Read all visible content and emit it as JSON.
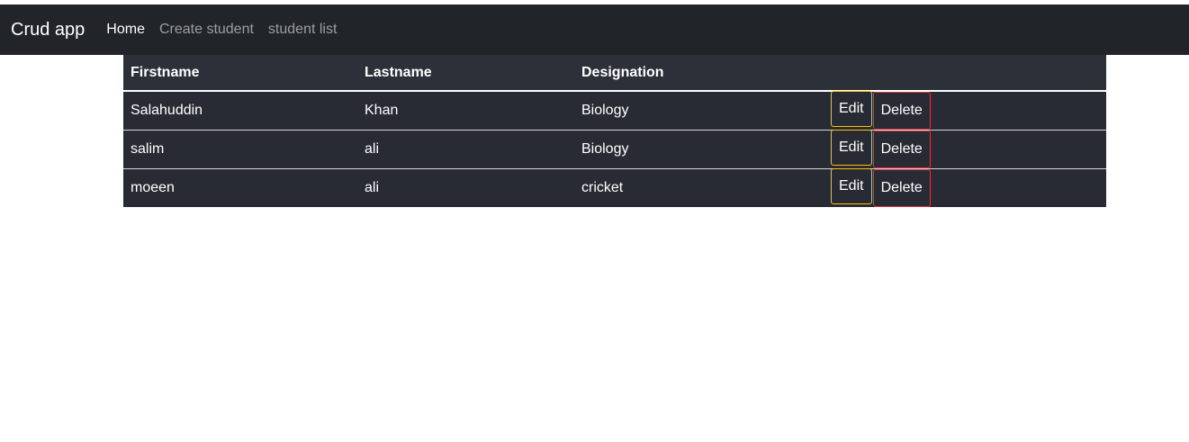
{
  "navbar": {
    "brand": "Crud app",
    "links": [
      {
        "label": "Home"
      },
      {
        "label": "Create student"
      },
      {
        "label": "student list"
      }
    ]
  },
  "table": {
    "headers": [
      "Firstname",
      "Lastname",
      "Designation",
      ""
    ],
    "rows": [
      {
        "firstname": "Salahuddin",
        "lastname": "Khan",
        "designation": "Biology"
      },
      {
        "firstname": "salim",
        "lastname": "ali",
        "designation": "Biology"
      },
      {
        "firstname": "moeen",
        "lastname": "ali",
        "designation": "cricket"
      }
    ],
    "edit_label": "Edit",
    "delete_label": "Delete"
  },
  "colors": {
    "navbar_bg": "#212529",
    "table_bg": "#282b33",
    "edit_border": "#ffc107",
    "delete_border": "#dc3545"
  }
}
